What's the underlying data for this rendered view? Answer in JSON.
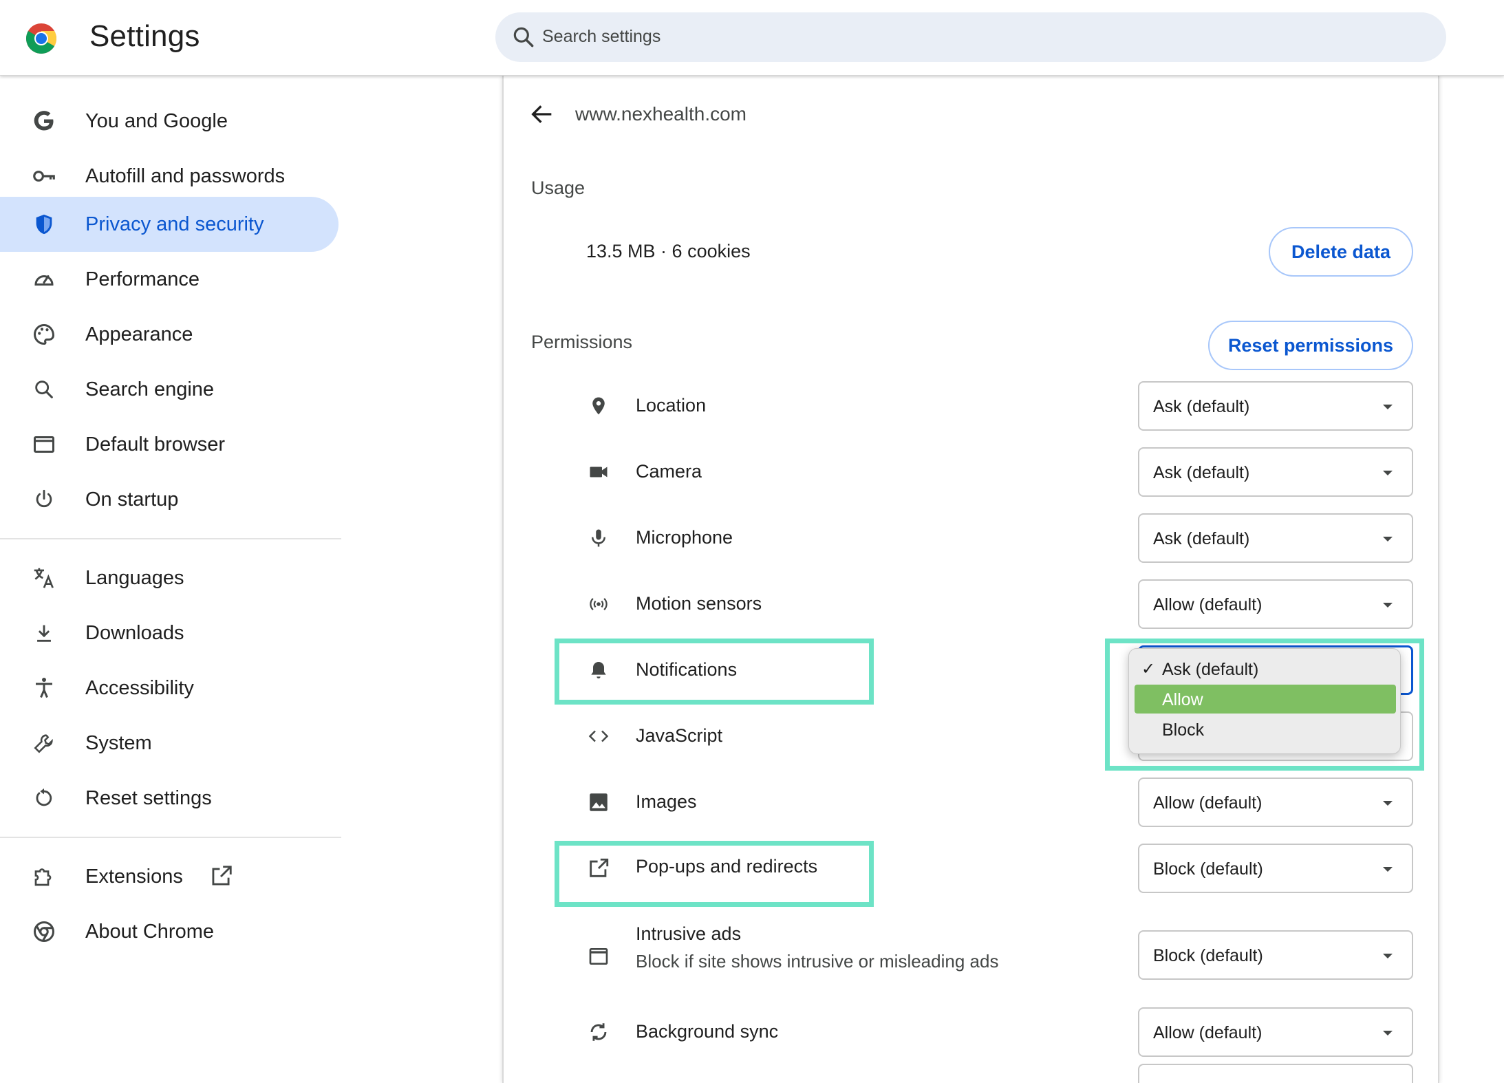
{
  "header": {
    "title": "Settings",
    "search_placeholder": "Search settings",
    "logo_icon": "chrome-logo-icon"
  },
  "sidebar": {
    "items": [
      {
        "label": "You and Google",
        "icon": "google-g-icon"
      },
      {
        "label": "Autofill and passwords",
        "icon": "key-icon"
      },
      {
        "label": "Privacy and security",
        "icon": "shield-icon",
        "active": true
      },
      {
        "label": "Performance",
        "icon": "speedometer-icon"
      },
      {
        "label": "Appearance",
        "icon": "palette-icon"
      },
      {
        "label": "Search engine",
        "icon": "search-icon"
      },
      {
        "label": "Default browser",
        "icon": "browser-window-icon"
      },
      {
        "label": "On startup",
        "icon": "power-icon"
      },
      {
        "label": "Languages",
        "icon": "translate-icon"
      },
      {
        "label": "Downloads",
        "icon": "download-icon"
      },
      {
        "label": "Accessibility",
        "icon": "accessibility-icon"
      },
      {
        "label": "System",
        "icon": "wrench-icon"
      },
      {
        "label": "Reset settings",
        "icon": "reset-icon"
      },
      {
        "label": "Extensions",
        "icon": "puzzle-icon",
        "external_icon": "open-in-new-icon"
      },
      {
        "label": "About Chrome",
        "icon": "chrome-icon"
      }
    ]
  },
  "site": {
    "title": "www.nexhealth.com",
    "usage_heading": "Usage",
    "usage_value": "13.5 MB · 6 cookies",
    "delete_button": "Delete data",
    "permissions_heading": "Permissions",
    "reset_button": "Reset permissions"
  },
  "permissions": [
    {
      "label": "Location",
      "icon": "location-pin-icon",
      "value": "Ask (default)"
    },
    {
      "label": "Camera",
      "icon": "camera-icon",
      "value": "Ask (default)"
    },
    {
      "label": "Microphone",
      "icon": "microphone-icon",
      "value": "Ask (default)"
    },
    {
      "label": "Motion sensors",
      "icon": "sensors-icon",
      "value": "Allow (default)"
    },
    {
      "label": "Notifications",
      "icon": "bell-icon",
      "value": "Ask (default)"
    },
    {
      "label": "JavaScript",
      "icon": "code-icon",
      "value": ""
    },
    {
      "label": "Images",
      "icon": "image-icon",
      "value": "Allow (default)"
    },
    {
      "label": "Pop-ups and redirects",
      "icon": "open-in-new-icon",
      "value": "Block (default)"
    },
    {
      "label": "Intrusive ads",
      "sublabel": "Block if site shows intrusive or misleading ads",
      "icon": "ad-window-icon",
      "value": "Block (default)"
    },
    {
      "label": "Background sync",
      "icon": "sync-icon",
      "value": "Allow (default)"
    }
  ],
  "notifications_dropdown": {
    "options": [
      "Ask (default)",
      "Allow",
      "Block"
    ],
    "checked_index": 0,
    "hovered_index": 1,
    "check_glyph": "✓"
  },
  "colors": {
    "accent": "#0b57d0",
    "active_nav_bg": "#d3e3fd",
    "highlight": "#6de3c6",
    "dropdown_hover": "#7fbf62"
  }
}
